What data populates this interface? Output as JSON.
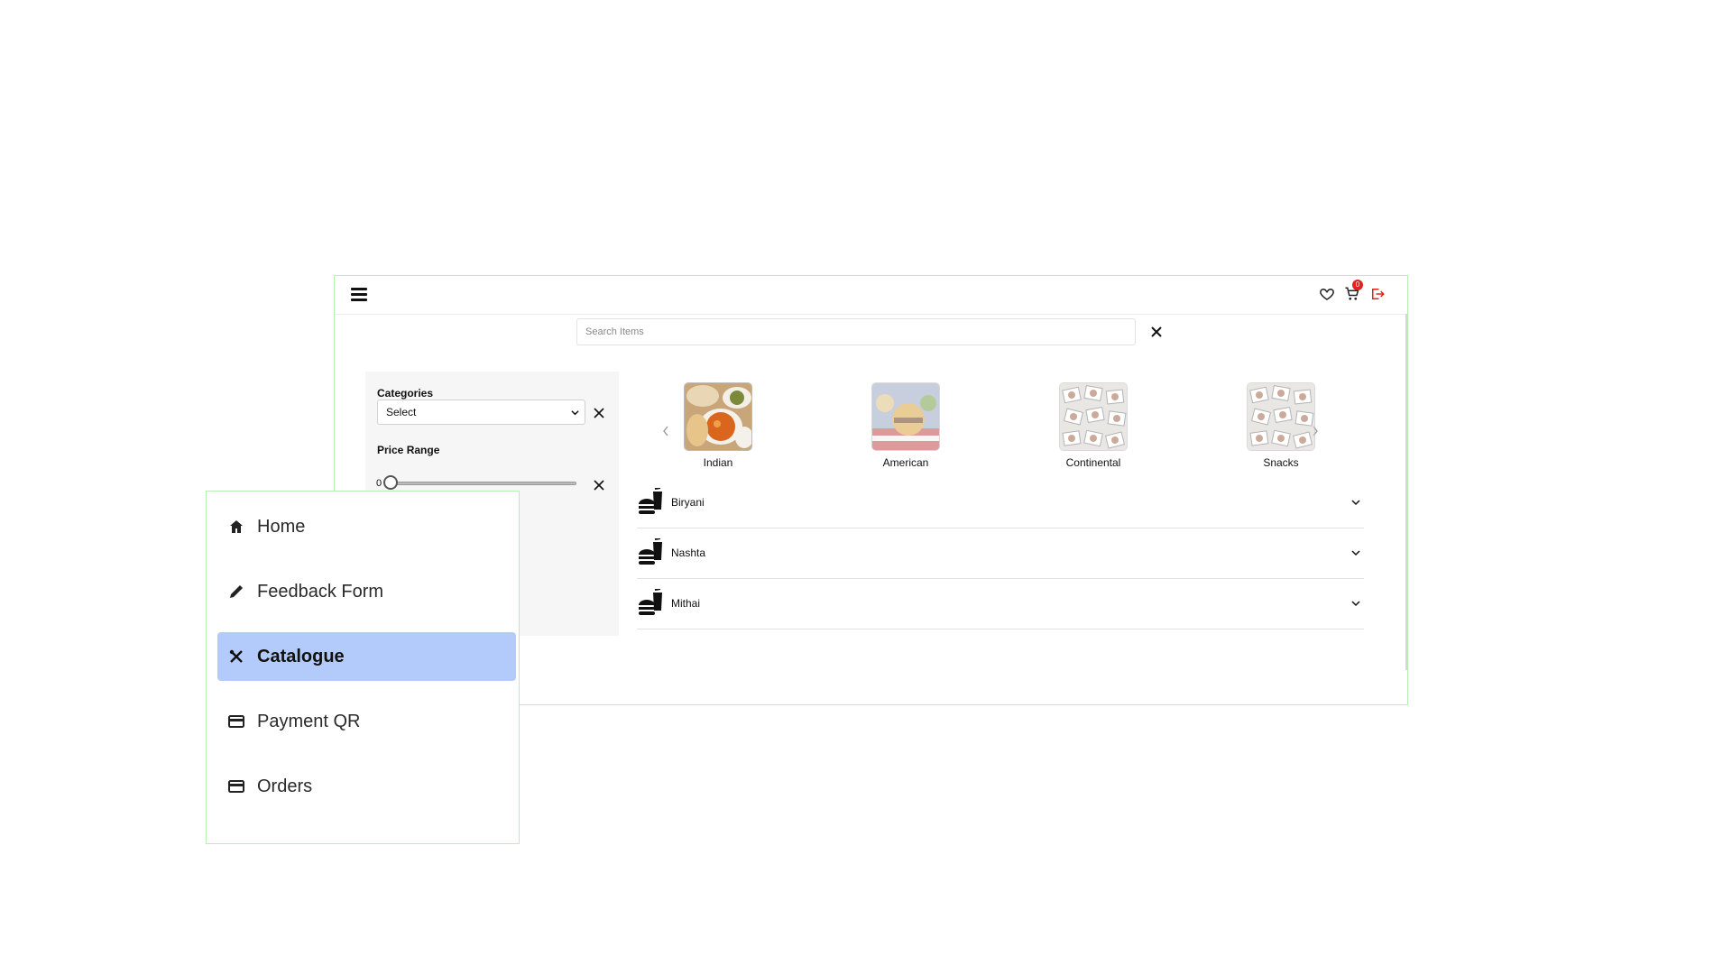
{
  "header": {
    "menu_icon": "hamburger-menu-icon",
    "wishlist_icon": "heart-icon",
    "cart_icon": "cart-icon",
    "cart_count": "0",
    "logout_icon": "logout-icon",
    "logout_color": "#e0241d"
  },
  "search": {
    "placeholder": "Search Items",
    "value": ""
  },
  "filters": {
    "categories_label": "Categories",
    "categories_selected": "Select",
    "price_label": "Price Range",
    "price_min_value": "0",
    "price_slider_fraction": 0
  },
  "categories": [
    {
      "name": "Indian",
      "image": "indian-thali-image"
    },
    {
      "name": "American",
      "image": "american-food-image"
    },
    {
      "name": "Continental",
      "image": "placeholder-collage-image"
    },
    {
      "name": "Snacks",
      "image": "placeholder-collage-image"
    }
  ],
  "menu_sections": [
    {
      "label": "Biryani",
      "icon": "fast-food-icon"
    },
    {
      "label": "Nashta",
      "icon": "fast-food-icon"
    },
    {
      "label": "Mithai",
      "icon": "fast-food-icon"
    }
  ],
  "sidebar": {
    "items": [
      {
        "label": "Home",
        "icon": "home-icon"
      },
      {
        "label": "Feedback Form",
        "icon": "pencil-icon"
      },
      {
        "label": "Catalogue",
        "icon": "fork-knife-icon",
        "active": true
      },
      {
        "label": "Payment QR",
        "icon": "credit-card-icon"
      },
      {
        "label": "Orders",
        "icon": "credit-card-icon"
      }
    ],
    "active_color": "#b3cbfb"
  },
  "colors": {
    "frame_border": "#b7f0b7",
    "badge": "#e0241d"
  }
}
